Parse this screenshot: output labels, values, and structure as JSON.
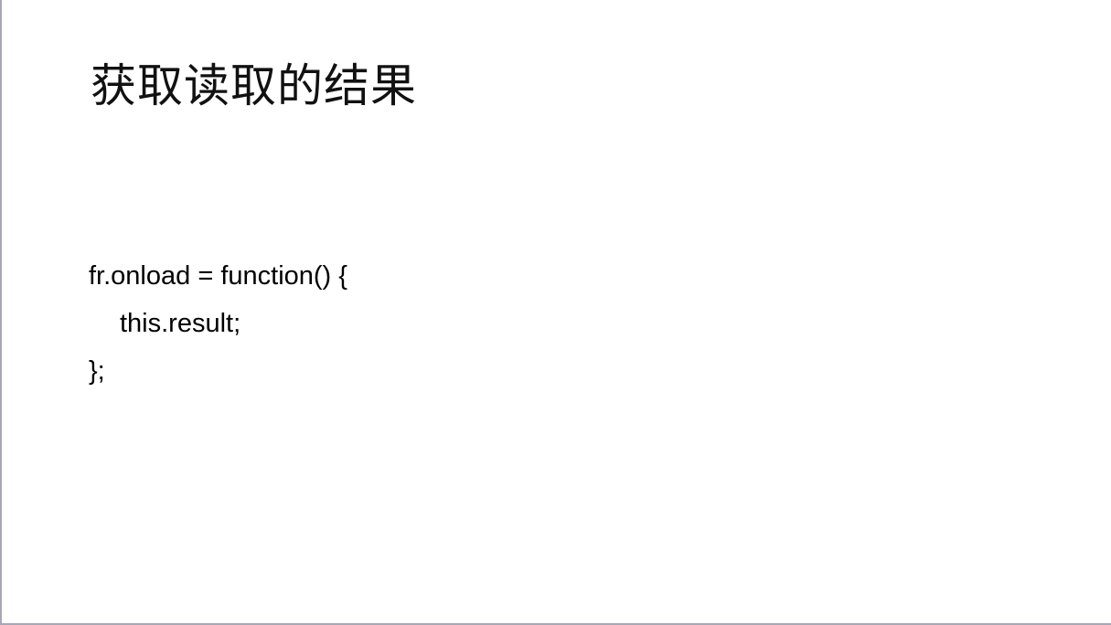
{
  "slide": {
    "title": "获取读取的结果",
    "code_lines": [
      {
        "before": "fr.onlo",
        "highlight": "a",
        "after": "d = function() {"
      },
      {
        "text": "this.result;"
      },
      {
        "text": "};"
      }
    ],
    "colors": {
      "background": "#ffffff",
      "text": "#000000",
      "cursor_highlight": "#ffdd00",
      "frame_border": "#a7a7b7"
    }
  }
}
